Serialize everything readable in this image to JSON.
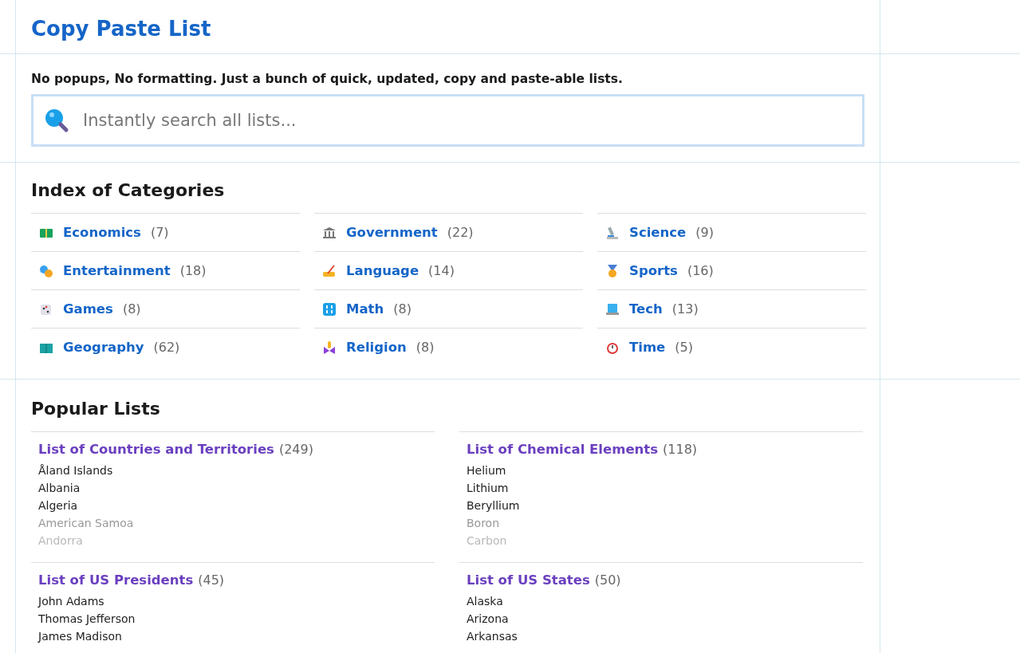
{
  "site_title": "Copy Paste List",
  "tagline": "No popups, No formatting. Just a bunch of quick, updated, copy and paste-able lists.",
  "search": {
    "placeholder": "Instantly search all lists..."
  },
  "categories": {
    "title": "Index of Categories",
    "columns": [
      [
        {
          "name": "Economics",
          "count": "(7)"
        },
        {
          "name": "Entertainment",
          "count": "(18)"
        },
        {
          "name": "Games",
          "count": "(8)"
        },
        {
          "name": "Geography",
          "count": "(62)"
        }
      ],
      [
        {
          "name": "Government",
          "count": "(22)"
        },
        {
          "name": "Language",
          "count": "(14)"
        },
        {
          "name": "Math",
          "count": "(8)"
        },
        {
          "name": "Religion",
          "count": "(8)"
        }
      ],
      [
        {
          "name": "Science",
          "count": "(9)"
        },
        {
          "name": "Sports",
          "count": "(16)"
        },
        {
          "name": "Tech",
          "count": "(13)"
        },
        {
          "name": "Time",
          "count": "(5)"
        }
      ]
    ]
  },
  "popular": {
    "title": "Popular Lists",
    "lists": [
      {
        "title": "List of Countries and Territories",
        "count": "(249)",
        "items": [
          {
            "text": "Åland Islands",
            "kind": "plain"
          },
          {
            "text": "Albania",
            "kind": "plain"
          },
          {
            "text": "Algeria",
            "kind": "plain"
          },
          {
            "text": "American Samoa",
            "kind": "fading"
          },
          {
            "text": "Andorra",
            "kind": "faint"
          }
        ]
      },
      {
        "title": "List of Chemical Elements",
        "count": "(118)",
        "items": [
          {
            "text": "Helium",
            "kind": "plain"
          },
          {
            "text": "Lithium",
            "kind": "plain"
          },
          {
            "text": "Beryllium",
            "kind": "plain"
          },
          {
            "text": "Boron",
            "kind": "fading"
          },
          {
            "text": "Carbon",
            "kind": "faint"
          }
        ]
      },
      {
        "title": "List of US Presidents",
        "count": "(45)",
        "items": [
          {
            "text": "John Adams",
            "kind": "plain"
          },
          {
            "text": "Thomas Jefferson",
            "kind": "plain"
          },
          {
            "text": "James Madison",
            "kind": "plain"
          }
        ]
      },
      {
        "title": "List of US States",
        "count": "(50)",
        "items": [
          {
            "text": "Alaska",
            "kind": "plain"
          },
          {
            "text": "Arizona",
            "kind": "plain"
          },
          {
            "text": "Arkansas",
            "kind": "plain"
          }
        ]
      }
    ]
  }
}
